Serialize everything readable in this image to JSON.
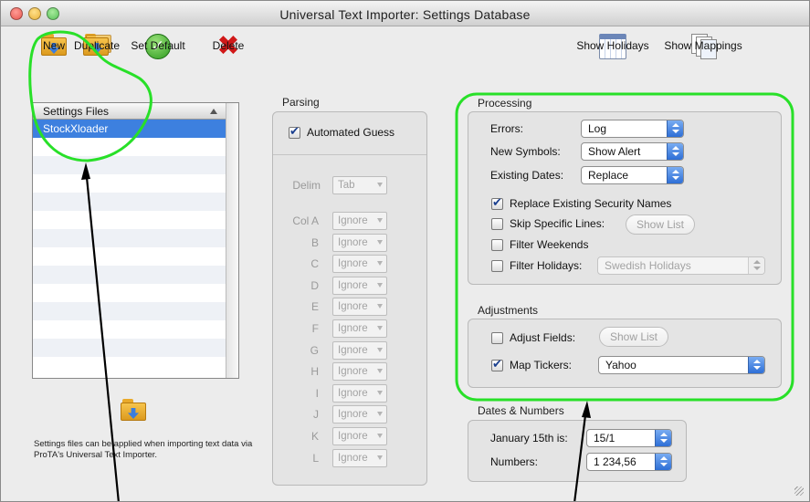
{
  "window": {
    "title": "Universal Text Importer: Settings Database",
    "colors": {
      "close": "#e8574f",
      "minimize": "#e9b23a",
      "zoom": "#59c25a",
      "selection": "#3d80df",
      "annotation": "#28e028"
    }
  },
  "toolbar": {
    "new_label": "New",
    "duplicate_label": "Duplicate",
    "set_default_label": "Set Default",
    "delete_label": "Delete",
    "show_holidays_label": "Show Holidays",
    "show_mappings_label": "Show Mappings",
    "icons": {
      "new": "folder-arrow-icon",
      "duplicate": "folders-icon",
      "set_default": "checkmark-icon",
      "delete": "x-icon",
      "show_holidays": "calendar-icon",
      "show_mappings": "documents-icon"
    }
  },
  "settings_list": {
    "header": "Settings Files",
    "items": [
      "StockXloader"
    ],
    "selected": "StockXloader"
  },
  "hint": {
    "text": "Settings files can be applied when importing text data via ProTA's Universal Text Importer."
  },
  "parsing": {
    "title": "Parsing",
    "automated_guess_label": "Automated Guess",
    "automated_guess_checked": true,
    "delim_label": "Delim",
    "delim_value": "Tab",
    "columns": [
      {
        "label": "Col A",
        "value": "Ignore"
      },
      {
        "label": "B",
        "value": "Ignore"
      },
      {
        "label": "C",
        "value": "Ignore"
      },
      {
        "label": "D",
        "value": "Ignore"
      },
      {
        "label": "E",
        "value": "Ignore"
      },
      {
        "label": "F",
        "value": "Ignore"
      },
      {
        "label": "G",
        "value": "Ignore"
      },
      {
        "label": "H",
        "value": "Ignore"
      },
      {
        "label": "I",
        "value": "Ignore"
      },
      {
        "label": "J",
        "value": "Ignore"
      },
      {
        "label": "K",
        "value": "Ignore"
      },
      {
        "label": "L",
        "value": "Ignore"
      }
    ]
  },
  "processing": {
    "title": "Processing",
    "errors_label": "Errors:",
    "errors_value": "Log",
    "new_symbols_label": "New Symbols:",
    "new_symbols_value": "Show Alert",
    "existing_dates_label": "Existing Dates:",
    "existing_dates_value": "Replace",
    "replace_names_label": "Replace Existing Security Names",
    "replace_names_checked": true,
    "skip_lines_label": "Skip Specific Lines:",
    "skip_lines_checked": false,
    "skip_show_list_label": "Show List",
    "filter_weekends_label": "Filter Weekends",
    "filter_weekends_checked": false,
    "filter_holidays_label": "Filter Holidays:",
    "filter_holidays_checked": false,
    "holidays_value": "Swedish Holidays"
  },
  "adjustments": {
    "title": "Adjustments",
    "adjust_fields_label": "Adjust Fields:",
    "adjust_fields_checked": false,
    "adjust_show_list_label": "Show List",
    "map_tickers_label": "Map Tickers:",
    "map_tickers_checked": true,
    "map_tickers_value": "Yahoo"
  },
  "dates_numbers": {
    "title": "Dates & Numbers",
    "january_label": "January 15th is:",
    "january_value": "15/1",
    "numbers_label": "Numbers:",
    "numbers_value": "1 234,56"
  }
}
